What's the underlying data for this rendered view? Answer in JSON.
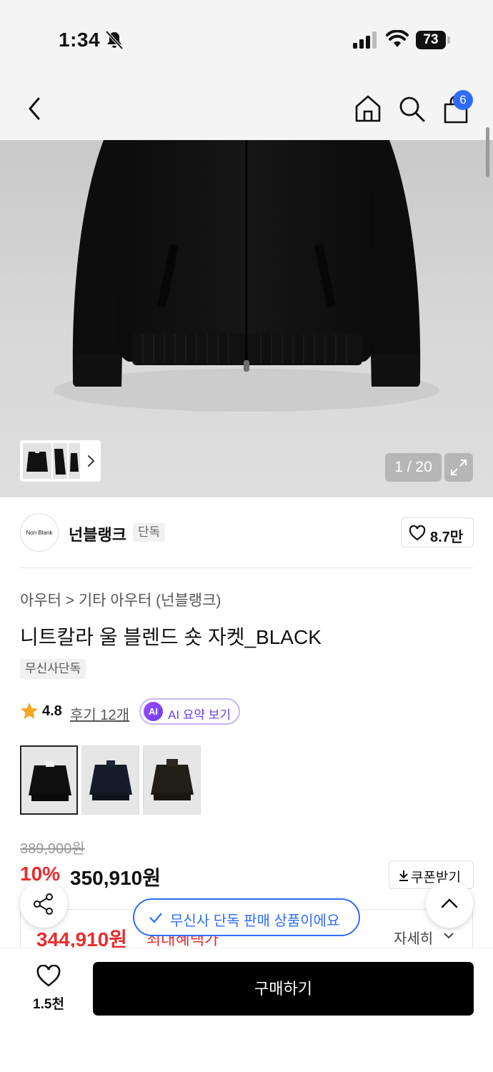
{
  "status_bar": {
    "time": "1:34",
    "battery": "73",
    "icons": [
      "bell-slash-icon",
      "signal-icon",
      "wifi-icon",
      "battery-icon"
    ]
  },
  "nav": {
    "icons": [
      "back-chevron-icon",
      "home-icon",
      "search-icon",
      "cart-icon"
    ],
    "cart_badge": "6"
  },
  "gallery": {
    "counter": "1 / 20",
    "icons": [
      "expand-icon",
      "chevron-right-icon"
    ]
  },
  "brand": {
    "logo_text": "Non Blank",
    "name": "넌블랭크",
    "tag": "단독",
    "likes": "8.7만"
  },
  "product": {
    "breadcrumb": "아우터 > 기타 아우터 (넌블랭크)",
    "title": "니트칼라 울 블렌드 숏 자켓_BLACK",
    "exclusive_tag": "무신사단독",
    "rating": "4.8",
    "reviews": "후기 12개",
    "ai_summary": {
      "icon_text": "AI",
      "label": "AI 요약 보기"
    },
    "color_swatches": [
      {
        "name": "black",
        "color": "#0f0f0f",
        "selected": true
      },
      {
        "name": "navy",
        "color": "#151b28",
        "selected": false
      },
      {
        "name": "brown",
        "color": "#211d17",
        "selected": false
      }
    ]
  },
  "price": {
    "original": "389,900원",
    "discount": "10%",
    "current": "350,910원",
    "coupon_button": "쿠폰받기",
    "final": "344,910원",
    "final_label": "최대혜택가",
    "detail_link": "자세히"
  },
  "toast": {
    "text": "무신사 단독 판매 상품이에요"
  },
  "bottom_bar": {
    "wishlist_count": "1.5천",
    "buy_label": "구매하기"
  },
  "colors": {
    "accent_blue": "#2e6cf6",
    "sale_red": "#e82d2d",
    "ai_purple": "#6a3df0",
    "star": "#f5a623"
  }
}
